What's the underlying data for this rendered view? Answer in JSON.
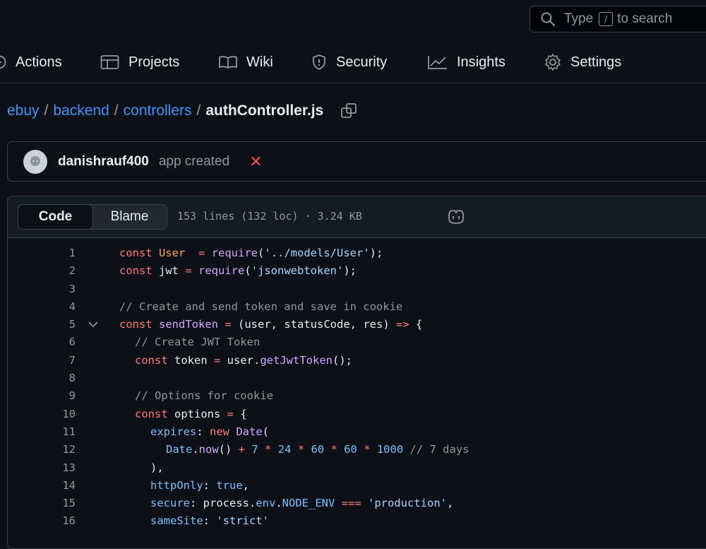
{
  "search": {
    "prefix": "Type",
    "key": "/",
    "suffix": "to search"
  },
  "nav": {
    "actions": "Actions",
    "projects": "Projects",
    "wiki": "Wiki",
    "security": "Security",
    "insights": "Insights",
    "settings": "Settings"
  },
  "breadcrumb": {
    "repo": "ebuy",
    "dir1": "backend",
    "dir2": "controllers",
    "file": "authController.js",
    "sep": "/"
  },
  "commit": {
    "author": "danishrauf400",
    "message": "app created",
    "status": "✕"
  },
  "viewer": {
    "tab_code": "Code",
    "tab_blame": "Blame",
    "info": "153 lines (132 loc) · 3.24 KB"
  },
  "code_lines": [
    {
      "n": "1",
      "ind": 0,
      "t": [
        [
          "k",
          "const "
        ],
        [
          "v",
          "User"
        ],
        [
          "",
          "  "
        ],
        [
          "k",
          "="
        ],
        [
          "",
          " "
        ],
        [
          "f",
          "require"
        ],
        [
          "",
          "("
        ],
        [
          "s",
          "'../models/User'"
        ],
        [
          "",
          ");"
        ]
      ]
    },
    {
      "n": "2",
      "ind": 0,
      "t": [
        [
          "k",
          "const "
        ],
        [
          "",
          "jwt "
        ],
        [
          "k",
          "="
        ],
        [
          "",
          " "
        ],
        [
          "f",
          "require"
        ],
        [
          "",
          "("
        ],
        [
          "s",
          "'jsonwebtoken'"
        ],
        [
          "",
          ");"
        ]
      ]
    },
    {
      "n": "3",
      "ind": 0,
      "t": []
    },
    {
      "n": "4",
      "ind": 0,
      "t": [
        [
          "c",
          "// Create and send token and save in cookie"
        ]
      ]
    },
    {
      "n": "5",
      "ind": 0,
      "fold": true,
      "t": [
        [
          "k",
          "const "
        ],
        [
          "f",
          "sendToken"
        ],
        [
          "",
          " "
        ],
        [
          "k",
          "="
        ],
        [
          "",
          " (user, statusCode, res) "
        ],
        [
          "k",
          "=>"
        ],
        [
          "",
          " {"
        ]
      ]
    },
    {
      "n": "6",
      "ind": 1,
      "t": [
        [
          "c",
          "// Create JWT Token"
        ]
      ]
    },
    {
      "n": "7",
      "ind": 1,
      "t": [
        [
          "k",
          "const "
        ],
        [
          "",
          "token "
        ],
        [
          "k",
          "="
        ],
        [
          "",
          " user."
        ],
        [
          "f",
          "getJwtToken"
        ],
        [
          "",
          "();"
        ]
      ]
    },
    {
      "n": "8",
      "ind": 0,
      "t": []
    },
    {
      "n": "9",
      "ind": 1,
      "t": [
        [
          "c",
          "// Options for cookie"
        ]
      ]
    },
    {
      "n": "10",
      "ind": 1,
      "t": [
        [
          "k",
          "const "
        ],
        [
          "",
          "options "
        ],
        [
          "k",
          "="
        ],
        [
          "",
          " {"
        ]
      ]
    },
    {
      "n": "11",
      "ind": 2,
      "t": [
        [
          "n",
          "expires"
        ],
        [
          "",
          ": "
        ],
        [
          "k",
          "new "
        ],
        [
          "f",
          "Date"
        ],
        [
          "",
          "("
        ]
      ]
    },
    {
      "n": "12",
      "ind": 3,
      "t": [
        [
          "n",
          "Date"
        ],
        [
          "",
          "."
        ],
        [
          "f",
          "now"
        ],
        [
          "",
          "() "
        ],
        [
          "k",
          "+"
        ],
        [
          "",
          " "
        ],
        [
          "n",
          "7"
        ],
        [
          "",
          " "
        ],
        [
          "k",
          "*"
        ],
        [
          "",
          " "
        ],
        [
          "n",
          "24"
        ],
        [
          "",
          " "
        ],
        [
          "k",
          "*"
        ],
        [
          "",
          " "
        ],
        [
          "n",
          "60"
        ],
        [
          "",
          " "
        ],
        [
          "k",
          "*"
        ],
        [
          "",
          " "
        ],
        [
          "n",
          "60"
        ],
        [
          "",
          " "
        ],
        [
          "k",
          "*"
        ],
        [
          "",
          " "
        ],
        [
          "n",
          "1000"
        ],
        [
          "",
          " "
        ],
        [
          "c",
          "// 7 days"
        ]
      ]
    },
    {
      "n": "13",
      "ind": 2,
      "t": [
        [
          "",
          "),"
        ]
      ]
    },
    {
      "n": "14",
      "ind": 2,
      "t": [
        [
          "n",
          "httpOnly"
        ],
        [
          "",
          ": "
        ],
        [
          "n",
          "true"
        ],
        [
          "",
          ","
        ]
      ]
    },
    {
      "n": "15",
      "ind": 2,
      "t": [
        [
          "n",
          "secure"
        ],
        [
          "",
          ": process."
        ],
        [
          "n",
          "env"
        ],
        [
          "",
          "."
        ],
        [
          "n",
          "NODE_ENV"
        ],
        [
          "",
          " "
        ],
        [
          "k",
          "==="
        ],
        [
          "",
          " "
        ],
        [
          "s",
          "'production'"
        ],
        [
          "",
          ","
        ]
      ]
    },
    {
      "n": "16",
      "ind": 2,
      "t": [
        [
          "n",
          "sameSite"
        ],
        [
          "",
          ": "
        ],
        [
          "s",
          "'strict'"
        ]
      ]
    }
  ]
}
